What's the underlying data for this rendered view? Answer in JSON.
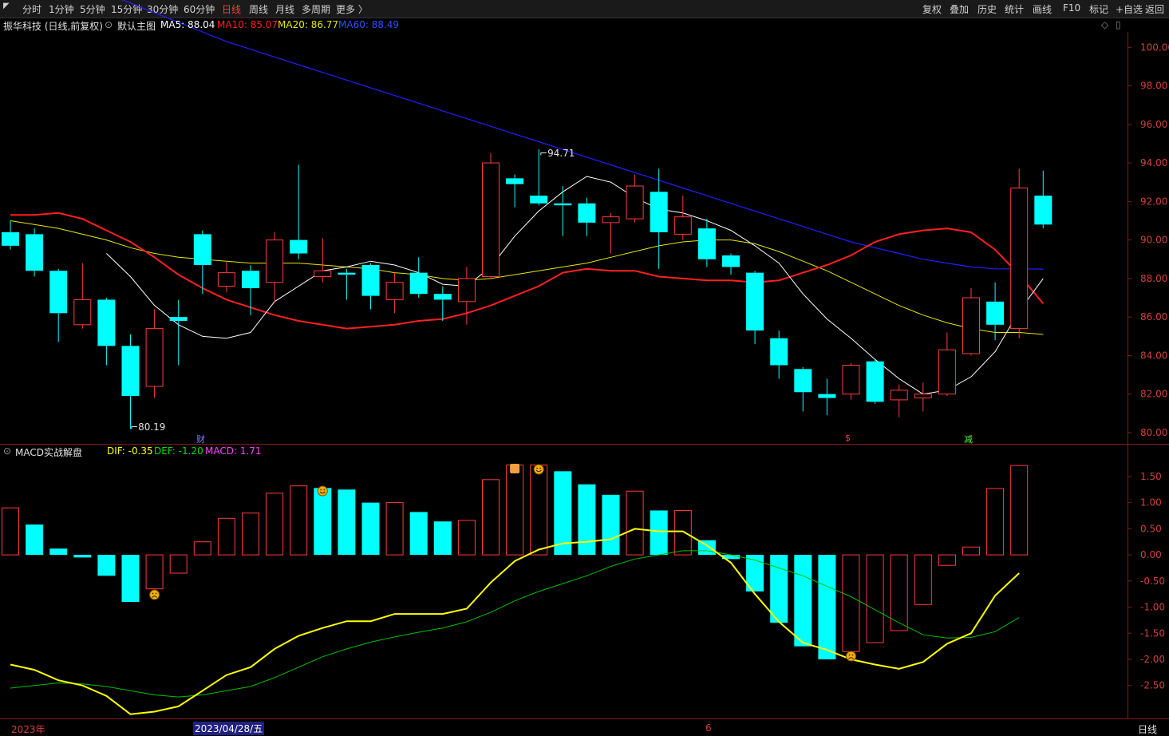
{
  "toolbar": {
    "periods": [
      "分时",
      "1分钟",
      "5分钟",
      "15分钟",
      "30分钟",
      "60分钟",
      "日线",
      "周线",
      "月线",
      "多周期",
      "更多 〉"
    ],
    "active_period": "日线",
    "right": [
      "复权",
      "叠加",
      "历史",
      "统计",
      "画线",
      "F10",
      "标记",
      "+自选",
      "返回"
    ]
  },
  "main_header": {
    "stock": "振华科技 (日线,前复权)",
    "indicator": "默认主图",
    "ma5": "MA5: 88.04",
    "ma10": "MA10: 85.07",
    "ma20": "MA20: 86.77",
    "ma60": "MA60: 88.49"
  },
  "macd_header": {
    "name": "MACD实战解盘",
    "dif": "DIF: -0.35",
    "def": "DEF: -1.20",
    "macd": "MACD: 1.71"
  },
  "annotations": {
    "high": "94.71",
    "low": "80.19"
  },
  "markers": [
    "财",
    "$",
    "减"
  ],
  "bottom_axis": {
    "year": "2023年",
    "date": "2023/04/28/五",
    "month": "6",
    "period": "日线"
  },
  "colors": {
    "up": "#ff3c3c",
    "down": "#00ffff",
    "ma5": "#ffffff",
    "ma10": "#ff2020",
    "ma20": "#e6e600",
    "ma60": "#2020ff",
    "dif": "#ffff00",
    "def": "#00c000"
  },
  "chart_data": {
    "type": "candlestick",
    "price_axis": {
      "ticks": [
        "100.00",
        "98.00",
        "96.00",
        "94.00",
        "92.00",
        "90.00",
        "88.00",
        "86.00",
        "84.00",
        "82.00",
        "80.00"
      ],
      "range": [
        79.5,
        100.8
      ]
    },
    "macd_axis": {
      "ticks": [
        "1.50",
        "1.00",
        "0.50",
        "0.00",
        "-0.50",
        "-1.00",
        "-1.50",
        "-2.00",
        "-2.50"
      ],
      "range": [
        -3.1,
        1.85
      ]
    },
    "candles": [
      {
        "o": 90.4,
        "c": 89.7,
        "h": 91.0,
        "l": 89.5
      },
      {
        "o": 90.3,
        "c": 88.4,
        "h": 90.6,
        "l": 88.1
      },
      {
        "o": 88.4,
        "c": 86.2,
        "h": 88.5,
        "l": 84.7
      },
      {
        "o": 85.6,
        "c": 86.9,
        "h": 88.8,
        "l": 85.4
      },
      {
        "o": 86.9,
        "c": 84.5,
        "h": 87.0,
        "l": 83.5
      },
      {
        "o": 84.5,
        "c": 81.9,
        "h": 85.1,
        "l": 80.19
      },
      {
        "o": 82.4,
        "c": 85.4,
        "h": 86.4,
        "l": 81.8
      },
      {
        "o": 86.0,
        "c": 85.8,
        "h": 86.9,
        "l": 83.5
      },
      {
        "o": 90.3,
        "c": 88.7,
        "h": 90.5,
        "l": 87.2
      },
      {
        "o": 87.6,
        "c": 88.3,
        "h": 88.9,
        "l": 87.3
      },
      {
        "o": 88.4,
        "c": 87.5,
        "h": 88.7,
        "l": 86.1
      },
      {
        "o": 87.8,
        "c": 90.0,
        "h": 90.4,
        "l": 86.8
      },
      {
        "o": 90.0,
        "c": 89.3,
        "h": 93.9,
        "l": 89.0
      },
      {
        "o": 88.1,
        "c": 88.4,
        "h": 90.1,
        "l": 87.8
      },
      {
        "o": 88.3,
        "c": 88.2,
        "h": 88.5,
        "l": 86.9
      },
      {
        "o": 88.7,
        "c": 87.1,
        "h": 88.8,
        "l": 86.4
      },
      {
        "o": 86.9,
        "c": 87.8,
        "h": 88.3,
        "l": 86.2
      },
      {
        "o": 88.3,
        "c": 87.2,
        "h": 89.1,
        "l": 87.0
      },
      {
        "o": 87.2,
        "c": 86.9,
        "h": 87.6,
        "l": 85.8
      },
      {
        "o": 86.8,
        "c": 88.0,
        "h": 88.6,
        "l": 85.6
      },
      {
        "o": 88.1,
        "c": 94.0,
        "h": 94.5,
        "l": 88.0
      },
      {
        "o": 93.2,
        "c": 92.9,
        "h": 93.4,
        "l": 91.7
      },
      {
        "o": 92.3,
        "c": 91.9,
        "h": 94.71,
        "l": 91.8
      },
      {
        "o": 91.9,
        "c": 91.8,
        "h": 92.8,
        "l": 90.2
      },
      {
        "o": 91.9,
        "c": 90.9,
        "h": 92.2,
        "l": 90.2
      },
      {
        "o": 90.9,
        "c": 91.2,
        "h": 91.4,
        "l": 89.3
      },
      {
        "o": 91.1,
        "c": 92.8,
        "h": 93.4,
        "l": 90.9
      },
      {
        "o": 92.5,
        "c": 90.4,
        "h": 93.7,
        "l": 88.5
      },
      {
        "o": 90.3,
        "c": 91.2,
        "h": 92.3,
        "l": 90.0
      },
      {
        "o": 90.6,
        "c": 89.0,
        "h": 91.1,
        "l": 88.6
      },
      {
        "o": 89.2,
        "c": 88.6,
        "h": 89.3,
        "l": 88.2
      },
      {
        "o": 88.3,
        "c": 85.3,
        "h": 88.4,
        "l": 84.6
      },
      {
        "o": 84.9,
        "c": 83.5,
        "h": 85.3,
        "l": 82.8
      },
      {
        "o": 83.3,
        "c": 82.1,
        "h": 83.4,
        "l": 81.1
      },
      {
        "o": 82.0,
        "c": 81.8,
        "h": 82.8,
        "l": 80.9
      },
      {
        "o": 82.0,
        "c": 83.5,
        "h": 83.6,
        "l": 81.7
      },
      {
        "o": 83.7,
        "c": 81.6,
        "h": 83.8,
        "l": 81.5
      },
      {
        "o": 81.7,
        "c": 82.2,
        "h": 82.5,
        "l": 80.8
      },
      {
        "o": 81.8,
        "c": 82.0,
        "h": 82.6,
        "l": 81.1
      },
      {
        "o": 82.0,
        "c": 84.3,
        "h": 85.2,
        "l": 81.9
      },
      {
        "o": 84.1,
        "c": 87.0,
        "h": 87.5,
        "l": 84.0
      },
      {
        "o": 86.8,
        "c": 85.6,
        "h": 87.8,
        "l": 84.8
      },
      {
        "o": 85.4,
        "c": 92.7,
        "h": 93.7,
        "l": 84.9
      },
      {
        "o": 92.3,
        "c": 90.8,
        "h": 93.6,
        "l": 90.6
      }
    ],
    "ma5": [
      null,
      null,
      null,
      null,
      89.3,
      88.1,
      86.6,
      85.6,
      85.0,
      84.9,
      85.2,
      86.8,
      87.6,
      88.4,
      88.6,
      88.9,
      88.7,
      88.3,
      87.7,
      87.6,
      88.6,
      90.2,
      91.5,
      92.5,
      93.3,
      93.0,
      92.2,
      91.6,
      91.4,
      91.0,
      90.5,
      89.7,
      88.8,
      87.2,
      85.9,
      84.9,
      83.8,
      82.8,
      82.0,
      82.2,
      82.9,
      84.2,
      86.3,
      88.0
    ],
    "ma10": [
      91.3,
      91.3,
      91.4,
      91.1,
      90.5,
      89.9,
      89.1,
      88.2,
      87.5,
      86.9,
      86.5,
      86.1,
      85.8,
      85.6,
      85.4,
      85.5,
      85.6,
      85.8,
      85.9,
      86.2,
      86.6,
      87.1,
      87.6,
      88.3,
      88.5,
      88.4,
      88.4,
      88.1,
      88.0,
      87.9,
      87.9,
      87.8,
      87.9,
      88.3,
      88.7,
      89.2,
      89.9,
      90.3,
      90.5,
      90.6,
      90.4,
      89.5,
      88.2,
      86.7
    ],
    "ma20": [
      91.0,
      90.8,
      90.6,
      90.3,
      90.0,
      89.6,
      89.3,
      89.1,
      89.0,
      88.9,
      88.8,
      88.8,
      88.8,
      88.7,
      88.6,
      88.5,
      88.3,
      88.2,
      88.0,
      87.9,
      88.0,
      88.2,
      88.4,
      88.6,
      88.8,
      89.1,
      89.4,
      89.7,
      89.9,
      90.0,
      90.0,
      89.8,
      89.4,
      88.9,
      88.4,
      87.8,
      87.2,
      86.6,
      86.1,
      85.7,
      85.4,
      85.2,
      85.2,
      85.1
    ],
    "ma60": [
      104.5,
      104.1,
      103.7,
      103.3,
      102.8,
      102.3,
      101.8,
      101.3,
      100.8,
      100.3,
      99.9,
      99.5,
      99.1,
      98.7,
      98.3,
      97.9,
      97.5,
      97.1,
      96.7,
      96.3,
      95.9,
      95.5,
      95.1,
      94.7,
      94.3,
      93.9,
      93.5,
      93.1,
      92.7,
      92.3,
      91.9,
      91.5,
      91.1,
      90.7,
      90.3,
      89.9,
      89.6,
      89.3,
      89.0,
      88.8,
      88.6,
      88.5,
      88.5,
      88.49
    ],
    "macd": [
      0.9,
      0.58,
      0.12,
      -0.05,
      -0.4,
      -0.9,
      -0.65,
      -0.35,
      0.25,
      0.7,
      0.8,
      1.18,
      1.32,
      1.28,
      1.25,
      1.0,
      1.0,
      0.82,
      0.64,
      0.66,
      1.44,
      1.72,
      1.72,
      1.6,
      1.35,
      1.15,
      1.22,
      0.85,
      0.85,
      0.28,
      -0.08,
      -0.7,
      -1.3,
      -1.75,
      -2.0,
      -1.85,
      -1.68,
      -1.45,
      -0.95,
      -0.2,
      0.15,
      1.27,
      1.71
    ],
    "dif": [
      -2.1,
      -2.2,
      -2.4,
      -2.5,
      -2.7,
      -3.05,
      -3.0,
      -2.9,
      -2.6,
      -2.3,
      -2.15,
      -1.8,
      -1.55,
      -1.4,
      -1.27,
      -1.27,
      -1.13,
      -1.13,
      -1.13,
      -1.03,
      -0.53,
      -0.12,
      0.1,
      0.22,
      0.25,
      0.3,
      0.5,
      0.45,
      0.45,
      0.18,
      -0.15,
      -0.75,
      -1.28,
      -1.68,
      -1.82,
      -2.0,
      -2.1,
      -2.18,
      -2.05,
      -1.7,
      -1.5,
      -0.78,
      -0.35
    ],
    "def": [
      -2.55,
      -2.5,
      -2.45,
      -2.47,
      -2.52,
      -2.6,
      -2.68,
      -2.72,
      -2.68,
      -2.6,
      -2.52,
      -2.35,
      -2.15,
      -1.95,
      -1.8,
      -1.67,
      -1.57,
      -1.48,
      -1.4,
      -1.28,
      -1.1,
      -0.88,
      -0.7,
      -0.55,
      -0.4,
      -0.22,
      -0.08,
      0.0,
      0.08,
      0.08,
      0.0,
      -0.1,
      -0.25,
      -0.4,
      -0.6,
      -0.8,
      -1.05,
      -1.3,
      -1.53,
      -1.59,
      -1.58,
      -1.47,
      -1.2
    ]
  }
}
